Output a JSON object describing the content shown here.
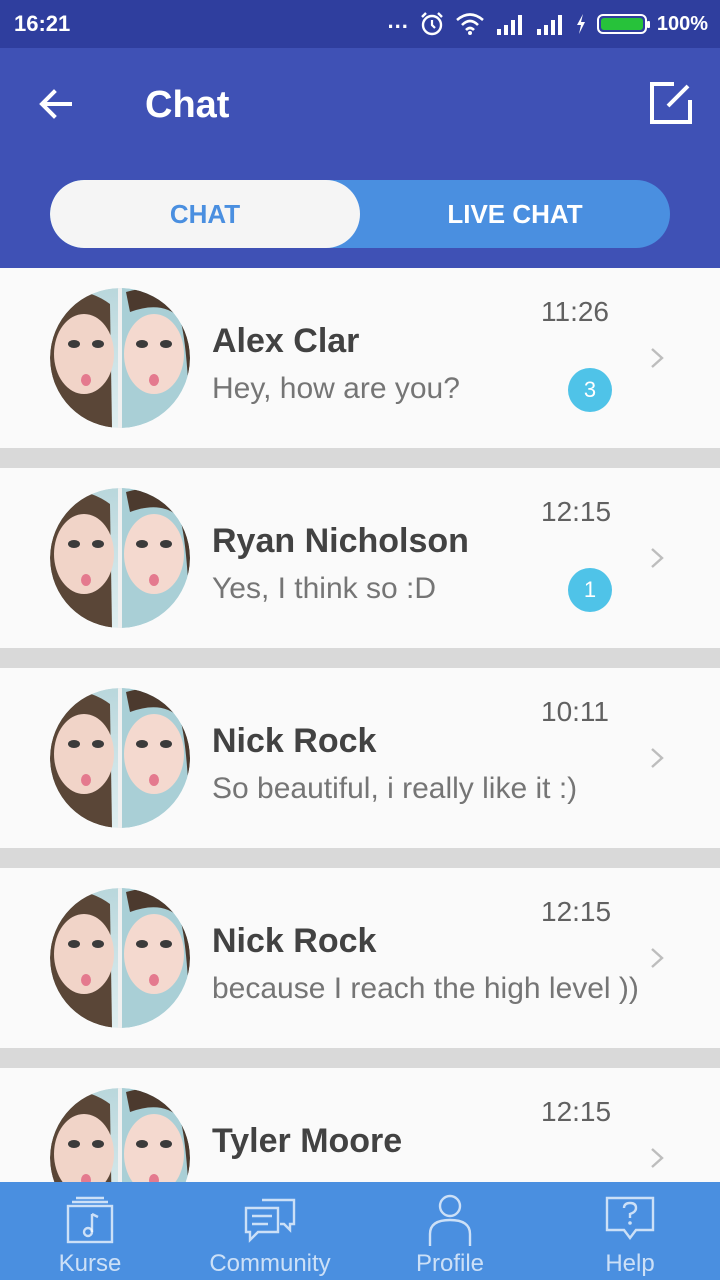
{
  "status": {
    "time": "16:21",
    "dots": "...",
    "battery": "100%",
    "battery_level": 1.0
  },
  "appbar": {
    "title": "Chat"
  },
  "tabs": [
    {
      "label": "CHAT",
      "active": true
    },
    {
      "label": "LIVE CHAT",
      "active": false
    }
  ],
  "chats": [
    {
      "name": "Alex Clar",
      "message": "Hey, how are you?",
      "time": "11:26",
      "unread": "3"
    },
    {
      "name": "Ryan Nicholson",
      "message": "Yes, I think so :D",
      "time": "12:15",
      "unread": "1"
    },
    {
      "name": "Nick Rock",
      "message": "So beautiful, i really like it :)",
      "time": "10:11",
      "unread": ""
    },
    {
      "name": "Nick Rock",
      "message": "because I reach the high level ))",
      "time": "12:15",
      "unread": ""
    },
    {
      "name": "Tyler Moore",
      "message": "",
      "time": "12:15",
      "unread": ""
    }
  ],
  "bottom_nav": [
    {
      "label": "Kurse",
      "icon": "music-book-icon"
    },
    {
      "label": "Community",
      "icon": "chat-bubbles-icon"
    },
    {
      "label": "Profile",
      "icon": "person-icon"
    },
    {
      "label": "Help",
      "icon": "help-bubble-icon"
    }
  ],
  "colors": {
    "status_bar": "#2f3e9e",
    "app_bar": "#3f51b5",
    "accent": "#4a8fe0",
    "badge": "#4fc3e8"
  }
}
